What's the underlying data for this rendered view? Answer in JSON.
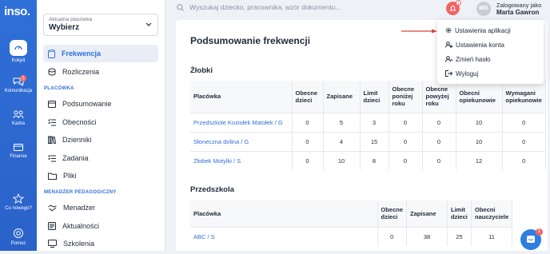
{
  "rail": {
    "logo": "inso.",
    "items": [
      {
        "label": "Kokpit"
      },
      {
        "label": "Komunikacja",
        "badge": "1"
      },
      {
        "label": "Kadra"
      },
      {
        "label": "Finanse"
      },
      {
        "label": "Co nowego?"
      },
      {
        "label": "Pomoc"
      }
    ]
  },
  "sidebar": {
    "selector_label": "Aktualna placówka",
    "selector_value": "Wybierz",
    "items": [
      {
        "label": "Frekwencja"
      },
      {
        "label": "Rozliczenia"
      }
    ],
    "section1": "PLACÓWKA",
    "placowka_items": [
      {
        "label": "Podsumowanie"
      },
      {
        "label": "Obecności"
      },
      {
        "label": "Dzienniki"
      },
      {
        "label": "Zadania"
      },
      {
        "label": "Pliki"
      }
    ],
    "section2": "MENADŻER PEDAGOGICZNY",
    "manager_items": [
      {
        "label": "Menadżer"
      },
      {
        "label": "Aktualności"
      },
      {
        "label": "Szkolenia"
      }
    ]
  },
  "header": {
    "search_placeholder": "Wyszukaj dziecko, pracownika, wzór dokumentu...",
    "bell_badge": "1",
    "avatar_initials": "MG",
    "logged_as": "Zalogowany jako",
    "user_name": "Marta Gawron"
  },
  "user_menu": [
    {
      "label": "Ustawienia aplikacji"
    },
    {
      "label": "Ustawienia konta"
    },
    {
      "label": "Zmień hasło"
    },
    {
      "label": "Wyloguj"
    }
  ],
  "main": {
    "title": "Podsumowanie frekwencji",
    "zlobki": {
      "heading": "Żłobki",
      "headers": [
        "Placówka",
        "Obecne dzieci",
        "Zapisane",
        "Limit dzieci",
        "Obecne poniżej roku",
        "Obecne powyżej roku",
        "Obecni opiekunowie",
        "Wymagani opiekunowie"
      ],
      "rows": [
        [
          "Przedszkole Koziołek Matołek / G",
          "0",
          "5",
          "3",
          "0",
          "0",
          "10",
          "0"
        ],
        [
          "Słoneczna dolina / G",
          "0",
          "4",
          "15",
          "0",
          "0",
          "10",
          "0"
        ],
        [
          "Żłobek Motylki / S",
          "0",
          "10",
          "8",
          "0",
          "0",
          "12",
          "0"
        ]
      ]
    },
    "przedszkola": {
      "heading": "Przedszkola",
      "headers": [
        "Placówka",
        "Obecne dzieci",
        "Zapisane",
        "Limit dzieci",
        "Obecni nauczyciele"
      ],
      "rows": [
        [
          "ABC / S",
          "0",
          "38",
          "25",
          "11"
        ]
      ]
    }
  },
  "chat_badge": "1"
}
